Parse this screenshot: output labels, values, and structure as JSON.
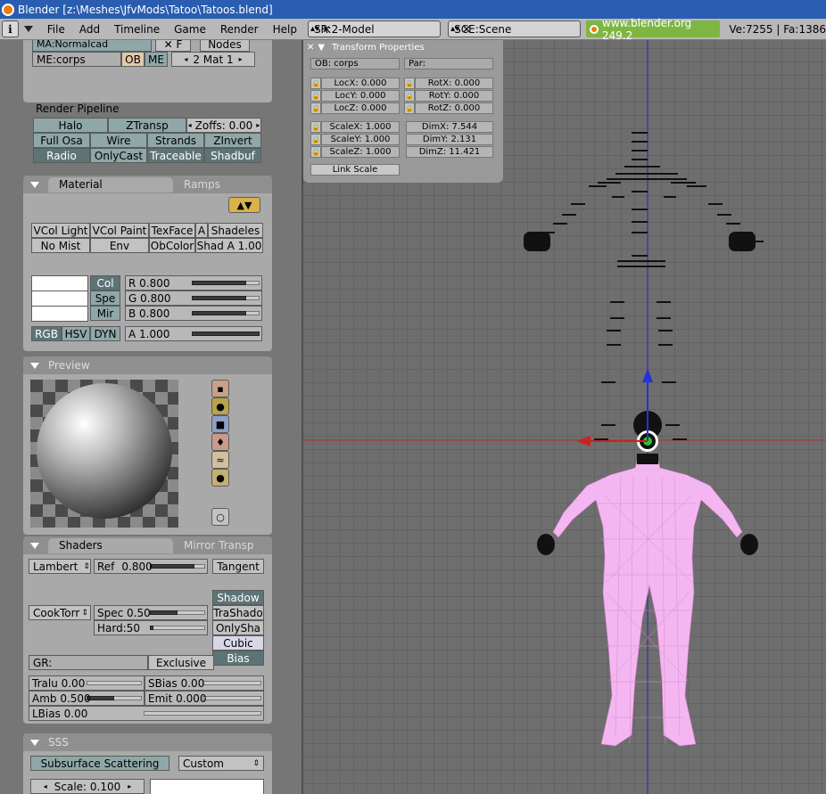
{
  "window": {
    "title": "Blender [z:\\Meshes\\JfvMods\\Tatoo\\Tatoos.blend]"
  },
  "menubar": {
    "items": [
      "File",
      "Add",
      "Timeline",
      "Game",
      "Render",
      "Help"
    ],
    "screen": "SR:2-Model",
    "scene": "SCE:Scene",
    "url": "www.blender.org 249.2",
    "stats": "Ve:7255 | Fa:1386"
  },
  "top_panel": {
    "partial_top": "MA:Normalcad",
    "node_label": "Nodes",
    "mesh": "ME:corps",
    "ob": "OB",
    "me": "ME",
    "mat_count": "2 Mat 1"
  },
  "render_pipeline": {
    "label": "Render Pipeline",
    "halo": "Halo",
    "ztransp": "ZTransp",
    "zoffs": "Zoffs: 0.00",
    "fullosa": "Full Osa",
    "wire": "Wire",
    "strands": "Strands",
    "zinvert": "ZInvert",
    "radio": "Radio",
    "onlycast": "OnlyCast",
    "traceable": "Traceable",
    "shadbuf": "Shadbuf"
  },
  "material_panel": {
    "tab_active": "Material",
    "tab_other": "Ramps",
    "vcol_light": "VCol Light",
    "vcol_paint": "VCol Paint",
    "texface": "TexFace",
    "a": "A",
    "shadeless": "Shadeles",
    "nomist": "No Mist",
    "env": "Env",
    "obcolor": "ObColor",
    "shad_a": "Shad A 1.00",
    "col": "Col",
    "spe": "Spe",
    "mir": "Mir",
    "r": "R 0.800",
    "g": "G 0.800",
    "b": "B 0.800",
    "rgb": "RGB",
    "hsv": "HSV",
    "dyn": "DYN",
    "alpha": "A 1.000",
    "r_value": 0.8,
    "g_value": 0.8,
    "b_value": 0.8,
    "alpha_value": 1.0
  },
  "preview_panel": {
    "title": "Preview"
  },
  "shaders_panel": {
    "tab_active": "Shaders",
    "tab_other": "Mirror Transp",
    "diffuse": "Lambert",
    "ref": "Ref",
    "ref_val": "0.800",
    "tangent": "Tangent",
    "shadow": "Shadow",
    "spec_shader": "CookTorr",
    "spec": "Spec 0.50",
    "trashadow": "TraShado",
    "hard": "Hard:50",
    "onlyshadow": "OnlySha",
    "cubic": "Cubic",
    "bias": "Bias",
    "gr": "GR:",
    "exclusive": "Exclusive",
    "tralu": "Tralu 0.00",
    "sbias": "SBias 0.00",
    "amb": "Amb 0.500",
    "emit": "Emit 0.000",
    "lbias": "LBias 0.00",
    "ref_value": 0.8,
    "spec_value": 0.5,
    "amb_value": 0.5
  },
  "sss_panel": {
    "title": "SSS",
    "sss_button": "Subsurface Scattering",
    "preset": "Custom",
    "scale": "Scale: 0.100"
  },
  "transform_properties": {
    "title": "Transform Properties",
    "ob": "OB: corps",
    "par": "Par:",
    "locx": "LocX: 0.000",
    "locy": "LocY: 0.000",
    "locz": "LocZ: 0.000",
    "rotx": "RotX: 0.000",
    "roty": "RotY: 0.000",
    "rotz": "RotZ: 0.000",
    "scalex": "ScaleX: 1.000",
    "scaley": "ScaleY: 1.000",
    "scalez": "ScaleZ: 1.000",
    "dimx": "DimX: 7.544",
    "dimy": "DimY: 2.131",
    "dimz": "DimZ: 11.421",
    "link_scale": "Link Scale"
  },
  "colors": {
    "titlebar": "#2a5db0",
    "mesh_wire": "#f4b6f0",
    "axis_x": "#cc2222",
    "axis_z": "#2233dd",
    "pivot": "#22cc22"
  }
}
